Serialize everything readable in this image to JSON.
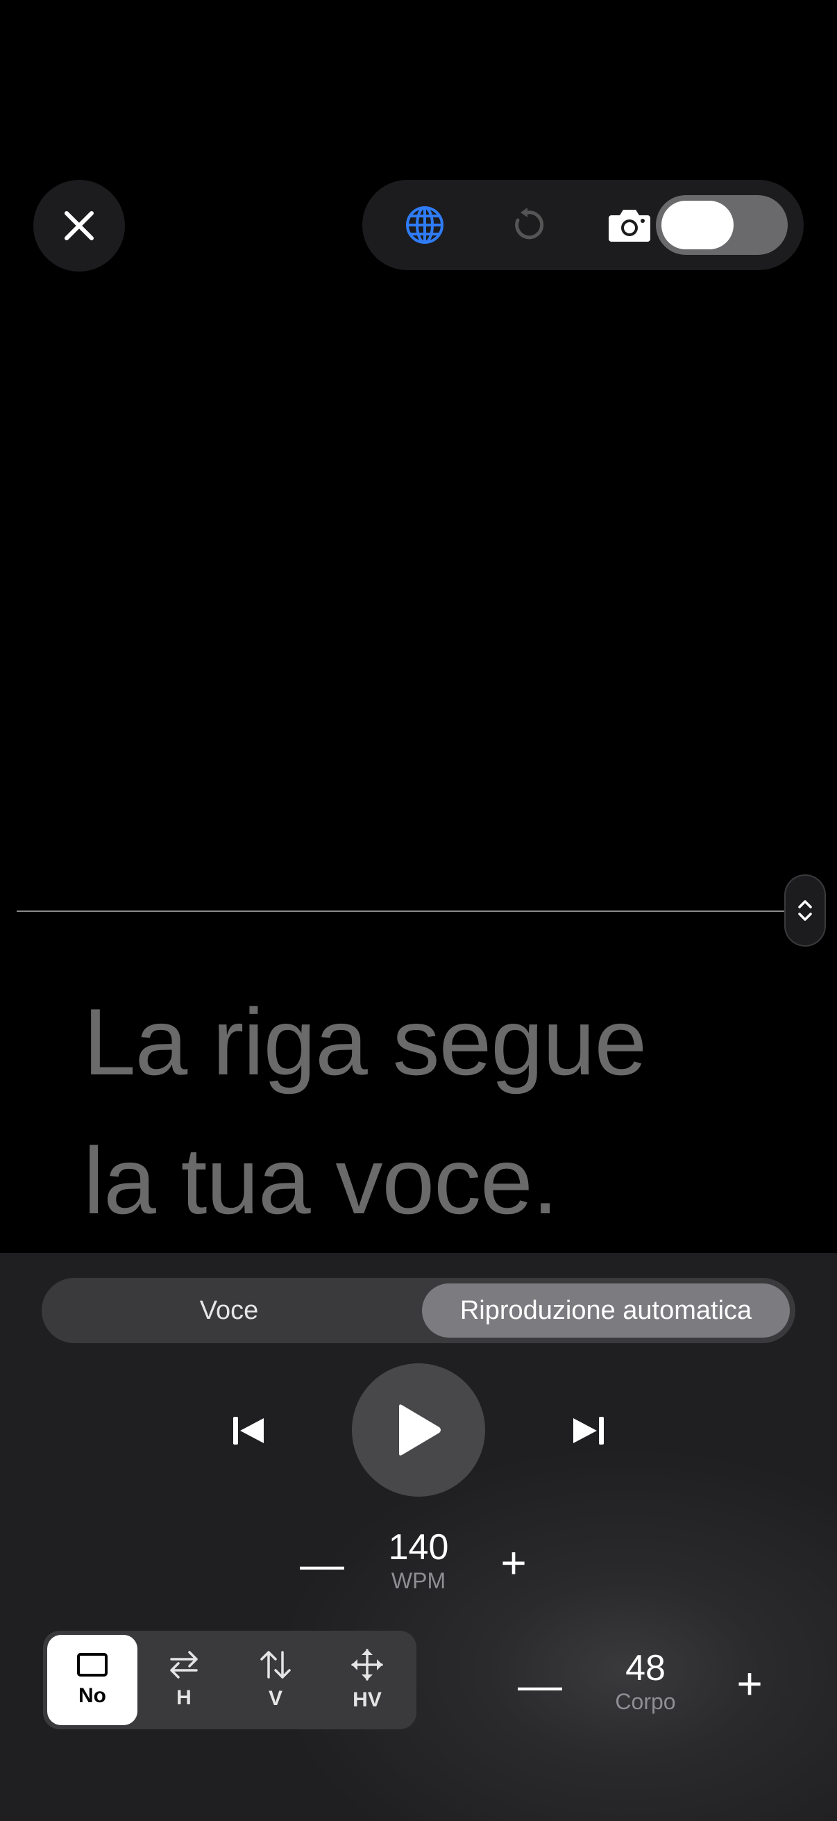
{
  "script": {
    "line1": "La riga segue",
    "line2": "la tua voce."
  },
  "mode": {
    "options": [
      "Voce",
      "Riproduzione automatica"
    ],
    "selected": "Riproduzione automatica"
  },
  "speed": {
    "value": "140",
    "unit": "WPM",
    "minus": "—",
    "plus": "+"
  },
  "scroll_mode": {
    "options": [
      {
        "label": "No",
        "icon": "square-icon"
      },
      {
        "label": "H",
        "icon": "horizontal-arrows-icon"
      },
      {
        "label": "V",
        "icon": "vertical-arrows-icon"
      },
      {
        "label": "HV",
        "icon": "move-arrows-icon"
      }
    ],
    "selected": "No"
  },
  "font_size": {
    "value": "48",
    "label": "Corpo",
    "minus": "—",
    "plus": "+"
  },
  "toolbar": {
    "icons": [
      "close-icon",
      "globe-icon",
      "rotate-icon",
      "camera-icon"
    ],
    "camera_toggle": true,
    "accent": "#2f7cf6"
  }
}
